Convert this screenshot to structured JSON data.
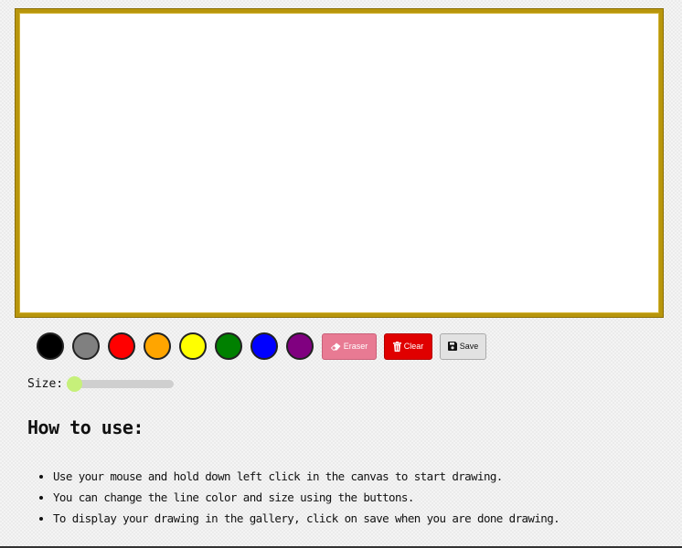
{
  "toolbar": {
    "colors": [
      {
        "name": "black",
        "hex": "#000000"
      },
      {
        "name": "gray",
        "hex": "#808080"
      },
      {
        "name": "red",
        "hex": "#ff0000"
      },
      {
        "name": "orange",
        "hex": "#ffa500"
      },
      {
        "name": "yellow",
        "hex": "#ffff00"
      },
      {
        "name": "green",
        "hex": "#008000"
      },
      {
        "name": "blue",
        "hex": "#0000ff"
      },
      {
        "name": "purple",
        "hex": "#800080"
      }
    ],
    "eraser": {
      "label": "Eraser",
      "icon": "eraser-icon",
      "color": "#e87a93"
    },
    "clear": {
      "label": "Clear",
      "icon": "trash-icon",
      "color": "#e00000"
    },
    "save": {
      "label": "Save",
      "icon": "floppy-disk-icon",
      "color": "#e2e2e2"
    }
  },
  "size": {
    "label": "Size:",
    "value_fraction": 0,
    "thumb_color": "#c6f07a"
  },
  "canvas": {
    "border_color": "#b8960c",
    "background": "#ffffff"
  },
  "howto": {
    "title": "How to use:",
    "items": [
      "Use your mouse and hold down left click in the canvas to start drawing.",
      "You can change the line color and size using the buttons.",
      "To display your drawing in the gallery, click on save when you are done drawing."
    ]
  }
}
